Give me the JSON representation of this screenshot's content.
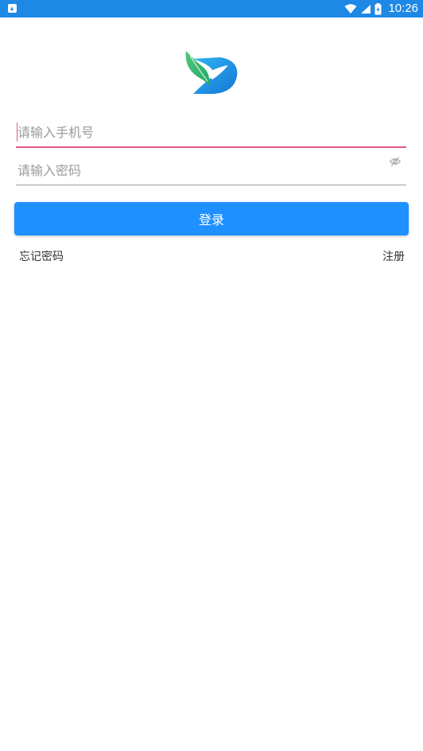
{
  "status_bar": {
    "time": "10:26",
    "color": "#1e88e5"
  },
  "form": {
    "phone_placeholder": "请输入手机号",
    "password_placeholder": "请输入密码",
    "login_label": "登录",
    "forgot_password_label": "忘记密码",
    "register_label": "注册"
  },
  "colors": {
    "primary": "#1e90ff",
    "focus_underline": "#e0588a",
    "logo_green": "#3cb878",
    "logo_blue": "#1a8fe3"
  }
}
